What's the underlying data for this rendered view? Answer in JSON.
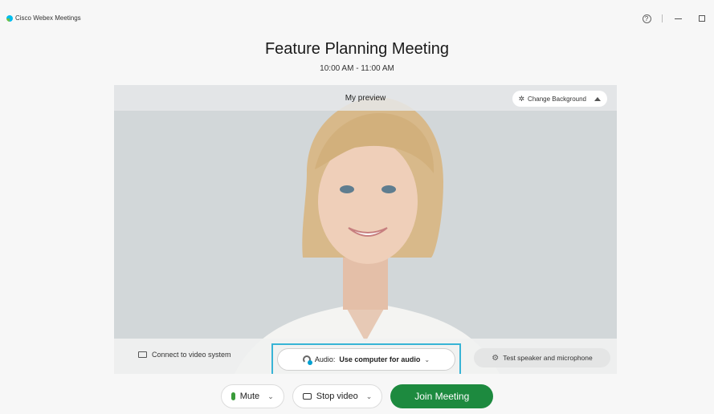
{
  "app": {
    "name": "Cisco Webex Meetings"
  },
  "window": {
    "help": "?",
    "minimize": "",
    "maximize": ""
  },
  "meeting": {
    "title": "Feature Planning Meeting",
    "time": "10:00 AM - 11:00 AM"
  },
  "preview": {
    "label": "My preview",
    "change_background": "Change Background",
    "connect_video": "Connect to video system",
    "audio_prefix": "Audio:",
    "audio_value": "Use computer for audio",
    "test_speaker": "Test speaker and microphone"
  },
  "controls": {
    "mute": "Mute",
    "stop_video": "Stop video",
    "join": "Join Meeting"
  },
  "colors": {
    "join": "#1d8a3f",
    "accent": "#38b4d6",
    "mic": "#3a9b3a"
  },
  "icons": [
    "logo-icon",
    "help-icon",
    "minimize-icon",
    "maximize-icon",
    "background-effects-icon",
    "caret-up-icon",
    "cast-icon",
    "headset-icon",
    "chevron-down-icon",
    "gear-icon",
    "mic-icon",
    "video-icon"
  ]
}
